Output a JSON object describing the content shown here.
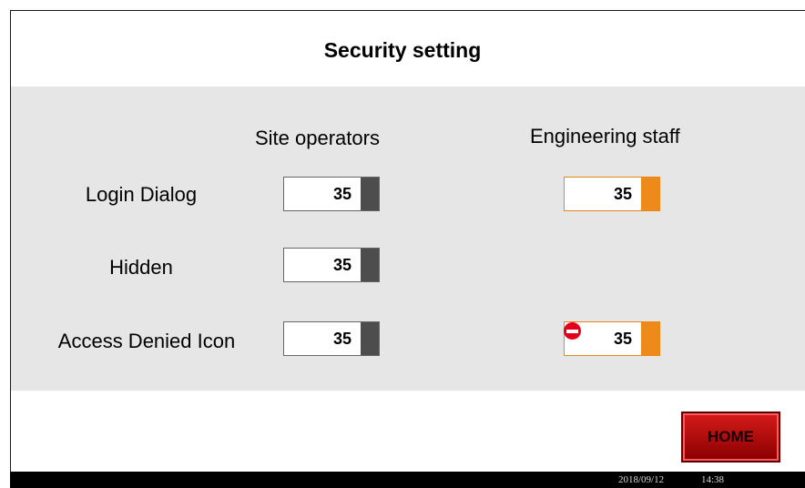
{
  "title": "Security setting",
  "columns": {
    "site_operators": "Site operators",
    "engineering_staff": "Engineering staff"
  },
  "rows": {
    "login_dialog": {
      "label": "Login Dialog",
      "site_value": "35",
      "eng_value": "35"
    },
    "hidden": {
      "label": "Hidden",
      "site_value": "35"
    },
    "access_denied_icon": {
      "label": "Access Denied Icon",
      "site_value": "35",
      "eng_value": "35",
      "eng_icon": "access-denied-icon"
    }
  },
  "home_button": {
    "label": "HOME"
  },
  "status_bar": {
    "date": "2018/09/12",
    "time": "14:38"
  },
  "colors": {
    "panel": "#e6e6e6",
    "orange_accent": "#ee8a1a",
    "gray_accent": "#4d4d4d",
    "home_red": "#b00000",
    "deny_red": "#e4001b"
  }
}
